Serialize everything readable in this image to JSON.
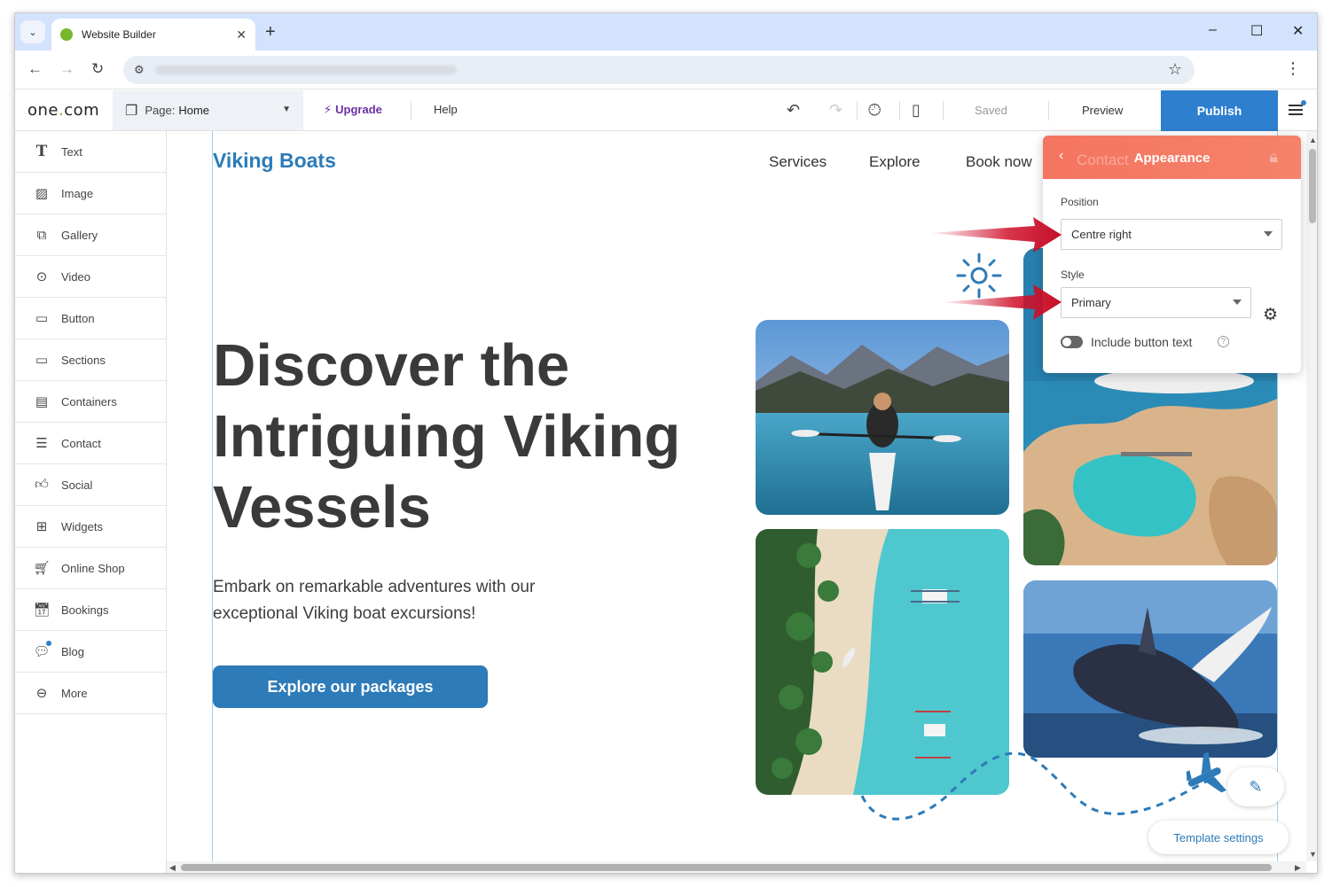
{
  "browser": {
    "tab_title": "Website Builder",
    "new_tab": "+",
    "minimize": "–",
    "maximize": "☐",
    "close": "✕"
  },
  "toolbar": {
    "logo_text": "one",
    "logo_dot": ".",
    "logo_suffix": "com",
    "page_label": "Page:",
    "page_name": "Home",
    "upgrade_label": "Upgrade",
    "help_label": "Help",
    "saved_label": "Saved",
    "preview_label": "Preview",
    "publish_label": "Publish"
  },
  "sidebar": {
    "items": [
      {
        "label": "Text",
        "icon": "text-icon"
      },
      {
        "label": "Image",
        "icon": "image-icon"
      },
      {
        "label": "Gallery",
        "icon": "gallery-icon"
      },
      {
        "label": "Video",
        "icon": "video-icon"
      },
      {
        "label": "Button",
        "icon": "button-icon"
      },
      {
        "label": "Sections",
        "icon": "sections-icon"
      },
      {
        "label": "Containers",
        "icon": "containers-icon"
      },
      {
        "label": "Contact",
        "icon": "contact-icon"
      },
      {
        "label": "Social",
        "icon": "social-icon"
      },
      {
        "label": "Widgets",
        "icon": "widgets-icon"
      },
      {
        "label": "Online Shop",
        "icon": "cart-icon"
      },
      {
        "label": "Bookings",
        "icon": "bookings-icon"
      },
      {
        "label": "Blog",
        "icon": "blog-icon"
      },
      {
        "label": "More",
        "icon": "more-icon"
      }
    ]
  },
  "site": {
    "logo": "Viking Boats",
    "nav": [
      "Services",
      "Explore",
      "Book now"
    ],
    "hero_title": "Discover the Intriguing Viking Vessels",
    "hero_subtitle": "Embark on remarkable adventures with our exceptional Viking boat excursions!",
    "cta_label": "Explore our packages"
  },
  "appearance_panel": {
    "ghost_text": "Contact",
    "title": "Appearance",
    "position_label": "Position",
    "position_value": "Centre right",
    "style_label": "Style",
    "style_value": "Primary",
    "include_text_label": "Include button text",
    "include_text_enabled": false,
    "help_glyph": "?"
  },
  "template_settings_label": "Template settings",
  "colors": {
    "brand_blue": "#2d7bb8",
    "publish_blue": "#2f7fcf",
    "panel_header": "#f47560",
    "upgrade_purple": "#6a2fa4",
    "annotation_red": "#d0102a"
  }
}
